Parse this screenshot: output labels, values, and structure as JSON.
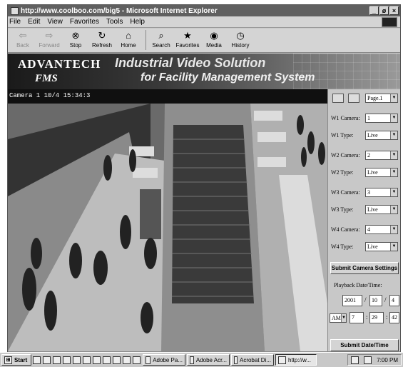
{
  "window": {
    "title": "http://www.coolboo.com/big5 - Microsoft Internet Explorer",
    "min": "_",
    "max": "ø",
    "close": "×"
  },
  "menu": [
    "File",
    "Edit",
    "View",
    "Favorites",
    "Tools",
    "Help"
  ],
  "toolbar": [
    {
      "label": "Back",
      "icon": "⇦",
      "disabled": true
    },
    {
      "label": "Forward",
      "icon": "⇨",
      "disabled": true
    },
    {
      "label": "Stop",
      "icon": "⊗",
      "disabled": false
    },
    {
      "label": "Refresh",
      "icon": "↻",
      "disabled": false
    },
    {
      "label": "Home",
      "icon": "⌂",
      "disabled": false
    },
    {
      "label": "Search",
      "icon": "⌕",
      "disabled": false
    },
    {
      "label": "Favorites",
      "icon": "★",
      "disabled": false
    },
    {
      "label": "Media",
      "icon": "◉",
      "disabled": false
    },
    {
      "label": "History",
      "icon": "◷",
      "disabled": false
    }
  ],
  "banner": {
    "logo_top": "ADVANTECH",
    "logo_bottom": "FMS",
    "line1": "Industrial Video Solution",
    "line2": "for Facility Management System"
  },
  "video": {
    "label": "Camera 1 10/4 15:34:3"
  },
  "panel": {
    "page_select": "Page.1",
    "rows": [
      {
        "label": "W1 Camera:",
        "value": "1"
      },
      {
        "label": "W1 Type:",
        "value": "Live"
      },
      {
        "label": "W2 Camera:",
        "value": "2"
      },
      {
        "label": "W2 Type:",
        "value": "Live"
      },
      {
        "label": "W3 Camera:",
        "value": "3"
      },
      {
        "label": "W3 Type:",
        "value": "Live"
      },
      {
        "label": "W4 Camera:",
        "value": "4"
      },
      {
        "label": "W4 Type:",
        "value": "Live"
      }
    ],
    "submit_camera": "Submit Camera Settings",
    "playback_label": "Playback Date/Time:",
    "year": "2001",
    "month": "10",
    "day": "4",
    "ampm": "AM",
    "hour": "7",
    "minute": "29",
    "second": "42",
    "submit_date": "Submit Date/Time Settings"
  },
  "taskbar": {
    "start": "Start",
    "tasks": [
      "Adobe Pa...",
      "Adobe Acr...",
      "Acrobat Di...",
      "http://w..."
    ],
    "clock": "7:00 PM"
  }
}
